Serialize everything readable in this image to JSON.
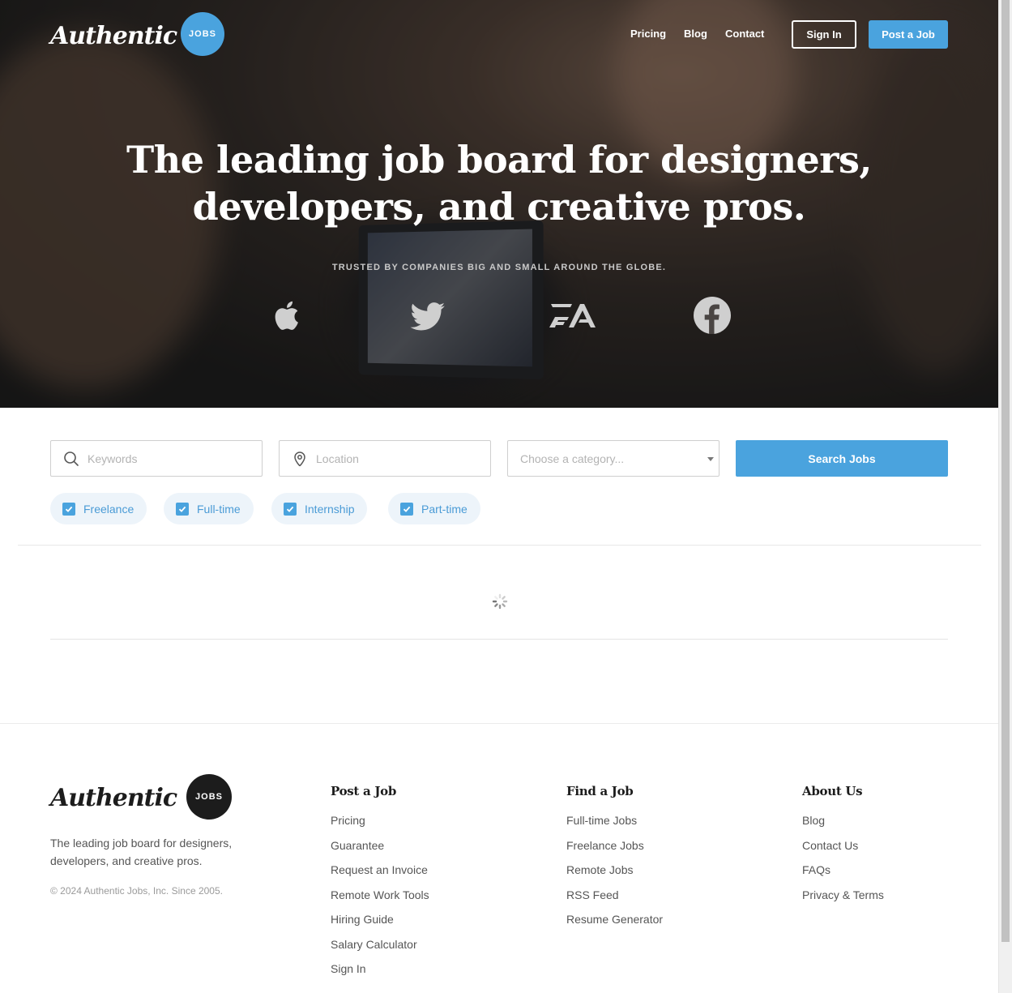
{
  "brand": {
    "logo_text": "Authentic",
    "badge_text": "JOBS",
    "colors": {
      "accent": "#4aa3de",
      "dark": "#1c1c1c"
    }
  },
  "nav": {
    "links": [
      "Pricing",
      "Blog",
      "Contact"
    ],
    "sign_in": "Sign In",
    "post_job": "Post a Job"
  },
  "hero": {
    "headline_line1": "The leading job board for designers,",
    "headline_line2": "developers, and creative pros.",
    "trusted": "TRUSTED BY COMPANIES BIG AND SMALL AROUND THE GLOBE.",
    "brands": [
      "apple-icon",
      "twitter-icon",
      "ea-icon",
      "facebook-icon"
    ]
  },
  "search": {
    "keywords_placeholder": "Keywords",
    "location_placeholder": "Location",
    "category_placeholder": "Choose a category...",
    "button": "Search Jobs",
    "filters": [
      {
        "label": "Freelance",
        "checked": true
      },
      {
        "label": "Full-time",
        "checked": true
      },
      {
        "label": "Internship",
        "checked": true
      },
      {
        "label": "Part-time",
        "checked": true
      }
    ]
  },
  "footer": {
    "tagline": "The leading job board for designers, developers, and creative pros.",
    "copyright": "© 2024 Authentic Jobs, Inc. Since 2005.",
    "columns": [
      {
        "title": "Post a Job",
        "links": [
          "Pricing",
          "Guarantee",
          "Request an Invoice",
          "Remote Work Tools",
          "Hiring Guide",
          "Salary Calculator",
          "Sign In"
        ]
      },
      {
        "title": "Find a Job",
        "links": [
          "Full-time Jobs",
          "Freelance Jobs",
          "Remote Jobs",
          "RSS Feed",
          "Resume Generator"
        ]
      },
      {
        "title": "About Us",
        "links": [
          "Blog",
          "Contact Us",
          "FAQs",
          "Privacy & Terms"
        ]
      }
    ]
  }
}
